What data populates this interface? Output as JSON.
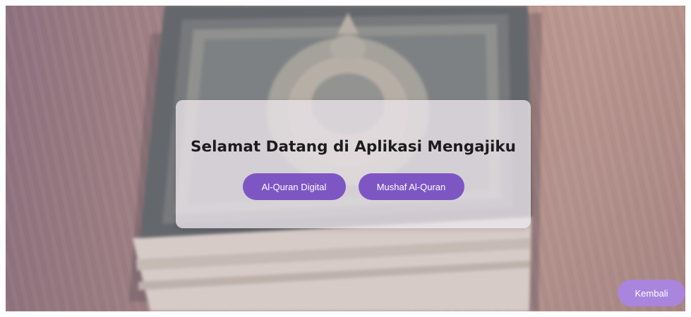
{
  "background": {
    "image": "quran-book-photo"
  },
  "welcome": {
    "title": "Selamat Datang di Aplikasi Mengajiku",
    "buttons": [
      {
        "label": "Al-Quran Digital"
      },
      {
        "label": "Mushaf Al-Quran"
      }
    ]
  },
  "footer": {
    "back_label": "Kembali"
  },
  "colors": {
    "button_primary": "#7e56c4",
    "button_back": "#a985dd",
    "card_background": "#ece6ea",
    "title_text": "#1c1c1c"
  }
}
